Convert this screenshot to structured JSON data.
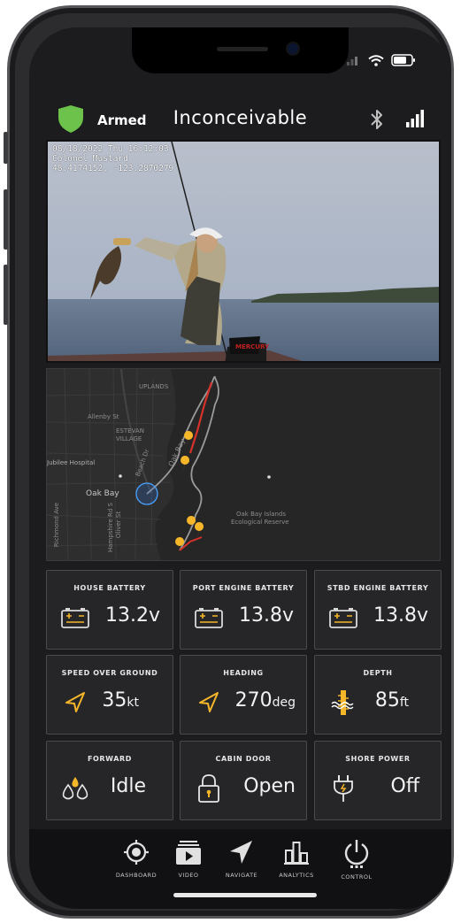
{
  "status": {
    "armed_label": "Armed",
    "vessel_name": "Inconceivable"
  },
  "video": {
    "overlay_lines": [
      "08/18/2022 Thu 16:12:03",
      "Colonel Mustard",
      "48.4174152, -123.2870279"
    ]
  },
  "map": {
    "labels": [
      "UPLANDS",
      "Allenby St",
      "ESTEVAN VILLAGE",
      "Jubilee Hospital",
      "Beach Dr",
      "Oak Bay",
      "Oak Bay",
      "Oak Bay Islands",
      "Ecological Reserve",
      "Hampshire Rd S",
      "Oliver St",
      "Richmond Ave"
    ]
  },
  "tiles": [
    {
      "title": "HOUSE BATTERY",
      "value": "13.2v",
      "unit": "",
      "icon": "battery-icon"
    },
    {
      "title": "PORT ENGINE BATTERY",
      "value": "13.8v",
      "unit": "",
      "icon": "battery-icon"
    },
    {
      "title": "STBD ENGINE BATTERY",
      "value": "13.8v",
      "unit": "",
      "icon": "battery-icon"
    },
    {
      "title": "SPEED OVER GROUND",
      "value": "35",
      "unit": "kt",
      "icon": "navigation-arrow-icon"
    },
    {
      "title": "HEADING",
      "value": "270",
      "unit": "deg",
      "icon": "navigation-arrow-icon"
    },
    {
      "title": "DEPTH",
      "value": "85",
      "unit": "ft",
      "icon": "depth-gauge-icon"
    },
    {
      "title": "FORWARD",
      "value": "Idle",
      "unit": "",
      "icon": "bilge-drops-icon"
    },
    {
      "title": "CABIN DOOR",
      "value": "Open",
      "unit": "",
      "icon": "lock-icon"
    },
    {
      "title": "SHORE POWER",
      "value": "Off",
      "unit": "",
      "icon": "plug-icon"
    }
  ],
  "nav": [
    "DASHBOARD",
    "VIDEO",
    "NAVIGATE",
    "ANALYTICS",
    "CONTROL"
  ],
  "colors": {
    "accent": "#f5b62a",
    "shield": "#6cc24a",
    "track_red": "#d6322a",
    "background": "#1c1c1e"
  }
}
